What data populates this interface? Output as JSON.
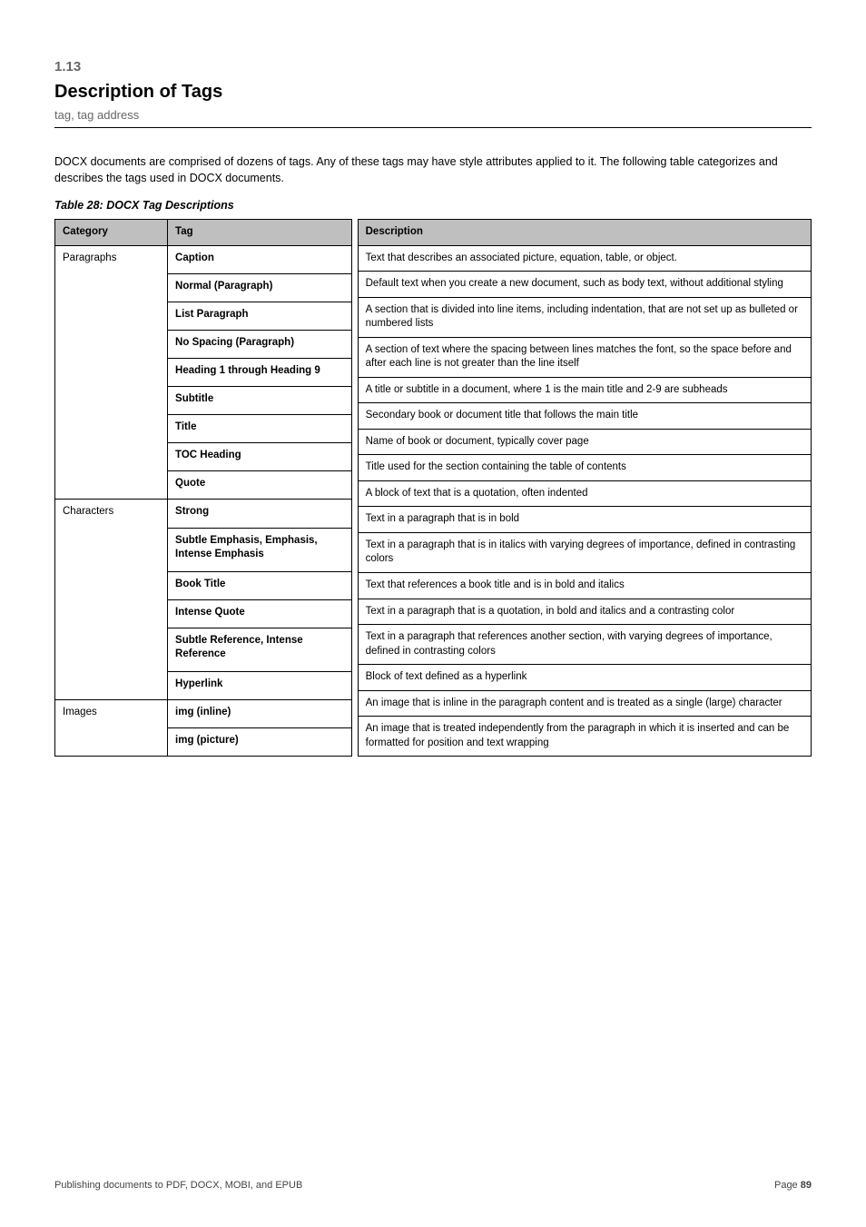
{
  "header": {
    "section_num": "1.13",
    "title": "Description of Tags",
    "subtitle": "tag, tag address"
  },
  "intro": "DOCX documents are comprised of dozens of tags. Any of these tags may have style attributes applied to it. The following table categorizes and describes the tags used in DOCX documents.",
  "table_title": "Table 28: DOCX Tag Descriptions",
  "columns": {
    "left": [
      "Category",
      "Tag"
    ],
    "right": "Description"
  },
  "groups": [
    {
      "category": "Paragraphs",
      "rows": [
        {
          "tag": "Caption",
          "desc": "Text that describes an associated picture, equation, table, or object."
        },
        {
          "tag": "Normal (Paragraph)",
          "desc": "Default text when you create a new document, such as body text, without additional styling"
        },
        {
          "tag": "List Paragraph",
          "desc": "A section that is divided into line items, including indentation, that are not set up as bulleted or numbered lists"
        },
        {
          "tag": "No Spacing (Paragraph)",
          "desc": "A section of text where the spacing between lines matches the font, so the space before and after each line is not greater than the line itself"
        },
        {
          "tag": "Heading 1 through Heading 9",
          "desc": "A title or subtitle in a document, where 1 is the main title and 2-9 are subheads"
        },
        {
          "tag": "Subtitle",
          "desc": "Secondary book or document title that follows the main title"
        },
        {
          "tag": "Title",
          "desc": "Name of book or document, typically cover page"
        },
        {
          "tag": "TOC Heading",
          "desc": "Title used for the section containing the table of contents"
        },
        {
          "tag": "Quote",
          "desc": "A block of text that is a quotation, often indented"
        }
      ]
    },
    {
      "category": "Characters",
      "rows": [
        {
          "tag": "Strong",
          "desc": "Text in a paragraph that is in bold"
        },
        {
          "tag": "Subtle Emphasis, Emphasis, Intense Emphasis",
          "desc": "Text in a paragraph that is in italics with varying degrees of importance, defined in contrasting colors"
        },
        {
          "tag": "Book Title",
          "desc": "Text that references a book title and is in bold and italics"
        },
        {
          "tag": "Intense Quote",
          "desc": "Text in a paragraph that is a quotation, in bold and italics and a contrasting color"
        },
        {
          "tag": "Subtle Reference, Intense Reference",
          "desc": "Text in a paragraph that references another section, with varying degrees of importance, defined in contrasting colors"
        },
        {
          "tag": "Hyperlink",
          "desc": "Block of text defined as a hyperlink"
        }
      ]
    },
    {
      "category": "Images",
      "rows": [
        {
          "tag": "img (inline)",
          "desc": "An image that is inline in the paragraph content and is treated as a single (large) character"
        },
        {
          "tag": "img (picture)",
          "desc": "An image that is treated independently from the paragraph in which it is inserted and can be formatted for position and text wrapping"
        }
      ]
    }
  ],
  "footer": {
    "left": "Publishing documents to PDF, DOCX, MOBI, and EPUB",
    "right_label": "Page",
    "page": "89"
  }
}
